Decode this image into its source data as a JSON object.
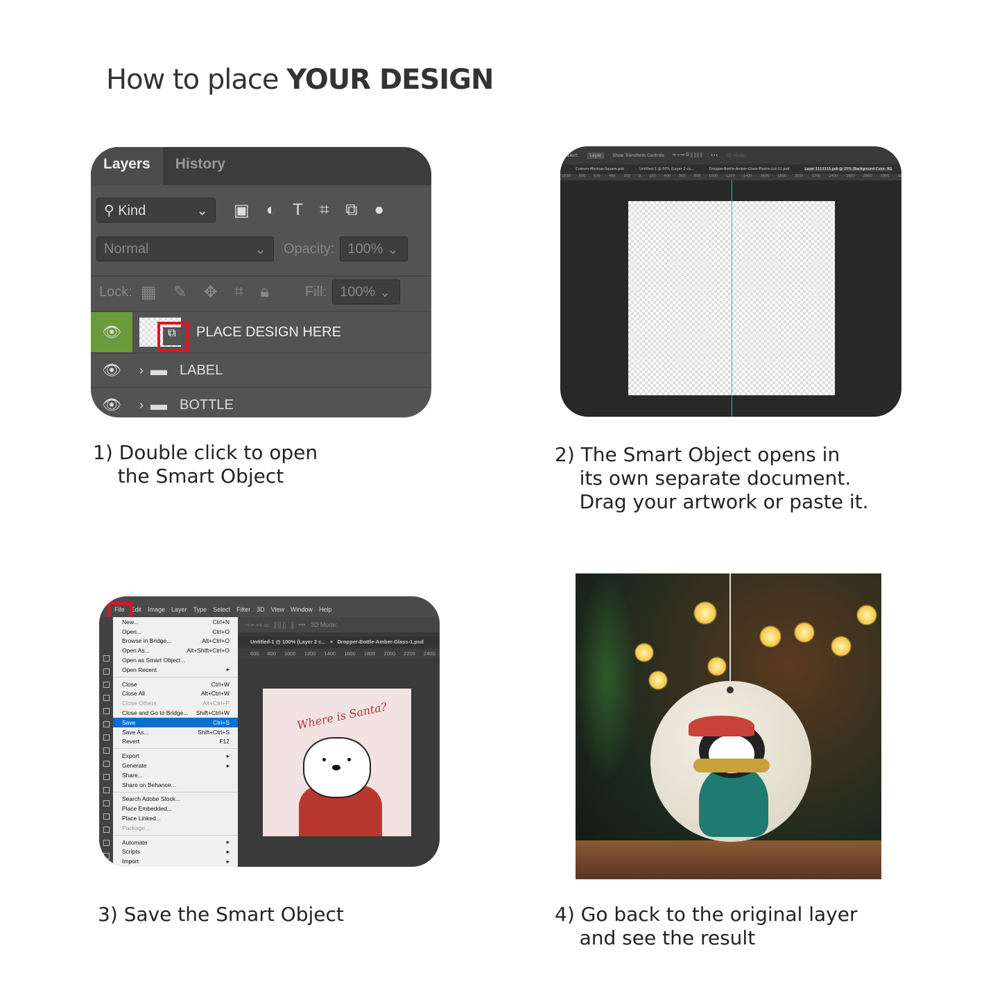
{
  "title": {
    "prefix": "How to place ",
    "emphasis": "YOUR DESIGN"
  },
  "step1": {
    "caption": "1) Double click to open\n    the Smart Object",
    "tabs": [
      "Layers",
      "History"
    ],
    "filter_label": "Kind",
    "blend_mode": "Normal",
    "opacity_label": "Opacity:",
    "opacity_value": "100%",
    "lock_label": "Lock:",
    "fill_label": "Fill:",
    "fill_value": "100%",
    "layers": [
      {
        "name": "PLACE DESIGN HERE",
        "type": "smart-object",
        "selected": true
      },
      {
        "name": "LABEL",
        "type": "folder"
      },
      {
        "name": "BOTTLE",
        "type": "folder"
      }
    ],
    "highlight_color": "#e0141e",
    "eye_selected_bg": "#6a9a3a"
  },
  "step2": {
    "caption": "2) The Smart Object opens in\n    its own separate document.\n    Drag your artwork or paste it.",
    "toolbar": {
      "select_label": "Select:",
      "select_value": "Layer",
      "transform_label": "Show Transform Controls",
      "mode_label": "3D Mode:"
    },
    "doc_tabs": [
      "Custom-Mockup-Square.psb",
      "Untitled-1 @ 50% (Layer 2 co...",
      "Dropper-Bottle-Amber-Glass-Plastic-Lid-11.psd",
      "Layer 1111111.psb @ 25% (Background Color, RG"
    ],
    "ruler": [
      "1000",
      "800",
      "600",
      "400",
      "200",
      "0",
      "200",
      "400",
      "600",
      "800",
      "1000",
      "1200",
      "1400",
      "1600",
      "1800",
      "2000",
      "2200",
      "2400",
      "2600",
      "2800",
      "3000",
      "3200",
      "3400",
      "3600",
      "3800"
    ]
  },
  "step3": {
    "caption": "3) Save the Smart Object",
    "menubar": [
      "File",
      "Edit",
      "Image",
      "Layer",
      "Type",
      "Select",
      "Filter",
      "3D",
      "View",
      "Window",
      "Help"
    ],
    "doc_tabs": [
      "Untitled-1 @ 100% (Layer 2 c...",
      "Dropper-Bottle-Amber-Glass-1.psd"
    ],
    "ruler": [
      "600",
      "800",
      "1000",
      "1200",
      "1400",
      "1600",
      "1800",
      "2000",
      "2200",
      "2400"
    ],
    "mode_label": "3D Mode:",
    "menu_groups": [
      [
        {
          "label": "New...",
          "shortcut": "Ctrl+N"
        },
        {
          "label": "Open...",
          "shortcut": "Ctrl+O"
        },
        {
          "label": "Browse in Bridge...",
          "shortcut": "Alt+Ctrl+O"
        },
        {
          "label": "Open As...",
          "shortcut": "Alt+Shift+Ctrl+O"
        },
        {
          "label": "Open as Smart Object...",
          "shortcut": ""
        },
        {
          "label": "Open Recent",
          "shortcut": "▸"
        }
      ],
      [
        {
          "label": "Close",
          "shortcut": "Ctrl+W"
        },
        {
          "label": "Close All",
          "shortcut": "Alt+Ctrl+W"
        },
        {
          "label": "Close Others",
          "shortcut": "Alt+Ctrl+P",
          "disabled": true
        },
        {
          "label": "Close and Go to Bridge...",
          "shortcut": "Shift+Ctrl+W"
        },
        {
          "label": "Save",
          "shortcut": "Ctrl+S",
          "highlighted": true
        },
        {
          "label": "Save As...",
          "shortcut": "Shift+Ctrl+S"
        },
        {
          "label": "Revert",
          "shortcut": "F12"
        }
      ],
      [
        {
          "label": "Export",
          "shortcut": "▸"
        },
        {
          "label": "Generate",
          "shortcut": "▸"
        },
        {
          "label": "Share...",
          "shortcut": ""
        },
        {
          "label": "Share on Behance...",
          "shortcut": ""
        }
      ],
      [
        {
          "label": "Search Adobe Stock...",
          "shortcut": ""
        },
        {
          "label": "Place Embedded...",
          "shortcut": ""
        },
        {
          "label": "Place Linked...",
          "shortcut": ""
        },
        {
          "label": "Package...",
          "shortcut": "",
          "disabled": true
        }
      ],
      [
        {
          "label": "Automate",
          "shortcut": "▸"
        },
        {
          "label": "Scripts",
          "shortcut": "▸"
        },
        {
          "label": "Import",
          "shortcut": "▸"
        }
      ]
    ],
    "artwork_text": "Where is Santa?"
  },
  "step4": {
    "caption": "4) Go back to the original layer\n    and see the result"
  }
}
